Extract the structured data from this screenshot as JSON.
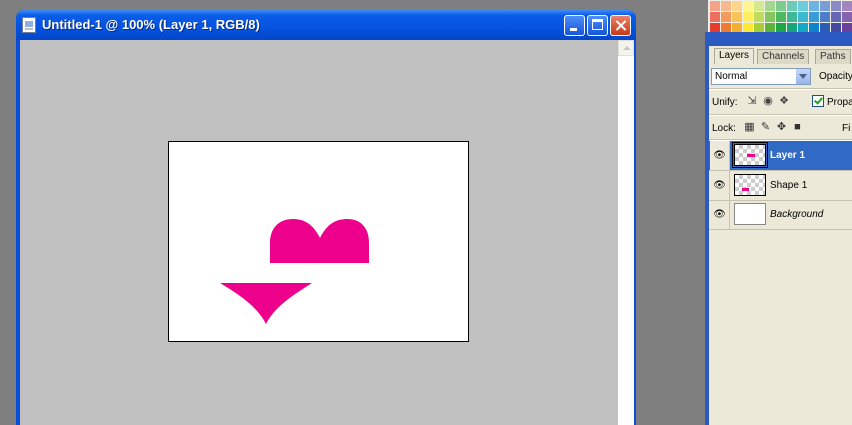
{
  "document_window": {
    "title": "Untitled-1 @ 100% (Layer 1, RGB/8)",
    "accent_color": "#0553de"
  },
  "canvas": {
    "background_color": "#ffffff",
    "shape_color": "#ec008c",
    "shapes": [
      "heart-top-half",
      "heart-bottom-half"
    ]
  },
  "swatches": {
    "colors": [
      "#f4a38b",
      "#f7b98c",
      "#fbd58c",
      "#fff68f",
      "#d4e88e",
      "#a5d68e",
      "#7ecb8f",
      "#6ccbb4",
      "#6bccdb",
      "#6bb3e3",
      "#7a9dd6",
      "#8a8bc6",
      "#a386bf",
      "#b98ac0",
      "#dc8ec3",
      "#ee6f5d",
      "#f39a5d",
      "#f8c25c",
      "#fff05f",
      "#bfdc5f",
      "#84c55f",
      "#4fb863",
      "#3fb897",
      "#3cbad0",
      "#3c9ad9",
      "#4f7cc9",
      "#6468b5",
      "#8462ad",
      "#a163ad",
      "#d064ad",
      "#e83b2f",
      "#f07a2f",
      "#f5ae2f",
      "#fde92f",
      "#a6cf35",
      "#5cb43a",
      "#1da645",
      "#15a67c",
      "#12a8c3",
      "#0f82cc",
      "#2a5cb8",
      "#4649a2",
      "#6b409a",
      "#8f3f99",
      "#c43d98"
    ]
  },
  "layers_panel": {
    "tabs": [
      {
        "label": "Layers",
        "active": true
      },
      {
        "label": "Channels",
        "active": false
      },
      {
        "label": "Paths",
        "active": false
      }
    ],
    "blend_mode": "Normal",
    "opacity_label": "Opacity",
    "unify_label": "Unify:",
    "propagate_label": "Propa",
    "propagate_checked": true,
    "lock_label": "Lock:",
    "fill_label": "Fi",
    "layers": [
      {
        "name": "Layer 1",
        "selected": true,
        "visible": true,
        "thumb": "transparent",
        "style": "bold"
      },
      {
        "name": "Shape 1",
        "selected": false,
        "visible": true,
        "thumb": "transparent",
        "style": "normal"
      },
      {
        "name": "Background",
        "selected": false,
        "visible": true,
        "thumb": "white",
        "style": "italic"
      }
    ],
    "selection_color": "#316ac5"
  }
}
